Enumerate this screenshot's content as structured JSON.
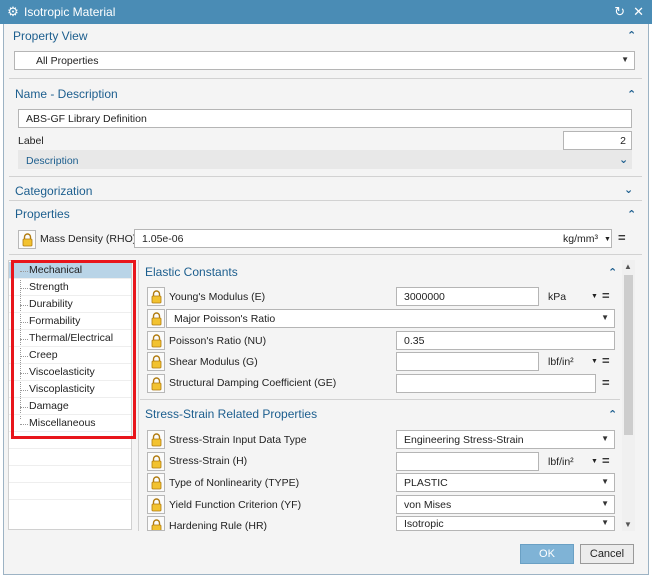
{
  "window": {
    "title": "Isotropic Material"
  },
  "property_view": {
    "header": "Property View",
    "selected": "All Properties"
  },
  "name_description": {
    "header": "Name - Description",
    "name_value": "ABS-GF Library Definition",
    "label_caption": "Label",
    "label_value": "2",
    "description_header": "Description"
  },
  "categorization": {
    "header": "Categorization"
  },
  "properties": {
    "header": "Properties",
    "mass_density_label": "Mass Density (RHO)",
    "mass_density_value": "1.05e-06",
    "mass_density_unit": "kg/mm³"
  },
  "nav": {
    "items": [
      {
        "label": "Mechanical"
      },
      {
        "label": "Strength"
      },
      {
        "label": "Durability"
      },
      {
        "label": "Formability"
      },
      {
        "label": "Thermal/Electrical"
      },
      {
        "label": "Creep"
      },
      {
        "label": "Viscoelasticity"
      },
      {
        "label": "Viscoplasticity"
      },
      {
        "label": "Damage"
      },
      {
        "label": "Miscellaneous"
      }
    ]
  },
  "elastic": {
    "header": "Elastic Constants",
    "youngs_label": "Young's Modulus (E)",
    "youngs_value": "3000000",
    "youngs_unit": "kPa",
    "poisson_type": "Major Poisson's Ratio",
    "poisson_label": "Poisson's Ratio (NU)",
    "poisson_value": "0.35",
    "shear_label": "Shear Modulus (G)",
    "shear_unit": "lbf/in²",
    "damping_label": "Structural Damping Coefficient (GE)"
  },
  "stress_strain": {
    "header": "Stress-Strain Related Properties",
    "input_type_label": "Stress-Strain Input Data Type",
    "input_type_value": "Engineering Stress-Strain",
    "h_label": "Stress-Strain (H)",
    "h_unit": "lbf/in²",
    "nonlinearity_label": "Type of Nonlinearity (TYPE)",
    "nonlinearity_value": "PLASTIC",
    "yield_label": "Yield Function Criterion (YF)",
    "yield_value": "von Mises",
    "hardening_label": "Hardening Rule (HR)",
    "hardening_value": "Isotropic"
  },
  "buttons": {
    "ok": "OK",
    "cancel": "Cancel"
  },
  "colors": {
    "titlebar": "#4a8cb5",
    "accent_text": "#1c5e8e",
    "highlight_border": "#e8151b",
    "ok_button": "#7fb3d6"
  }
}
